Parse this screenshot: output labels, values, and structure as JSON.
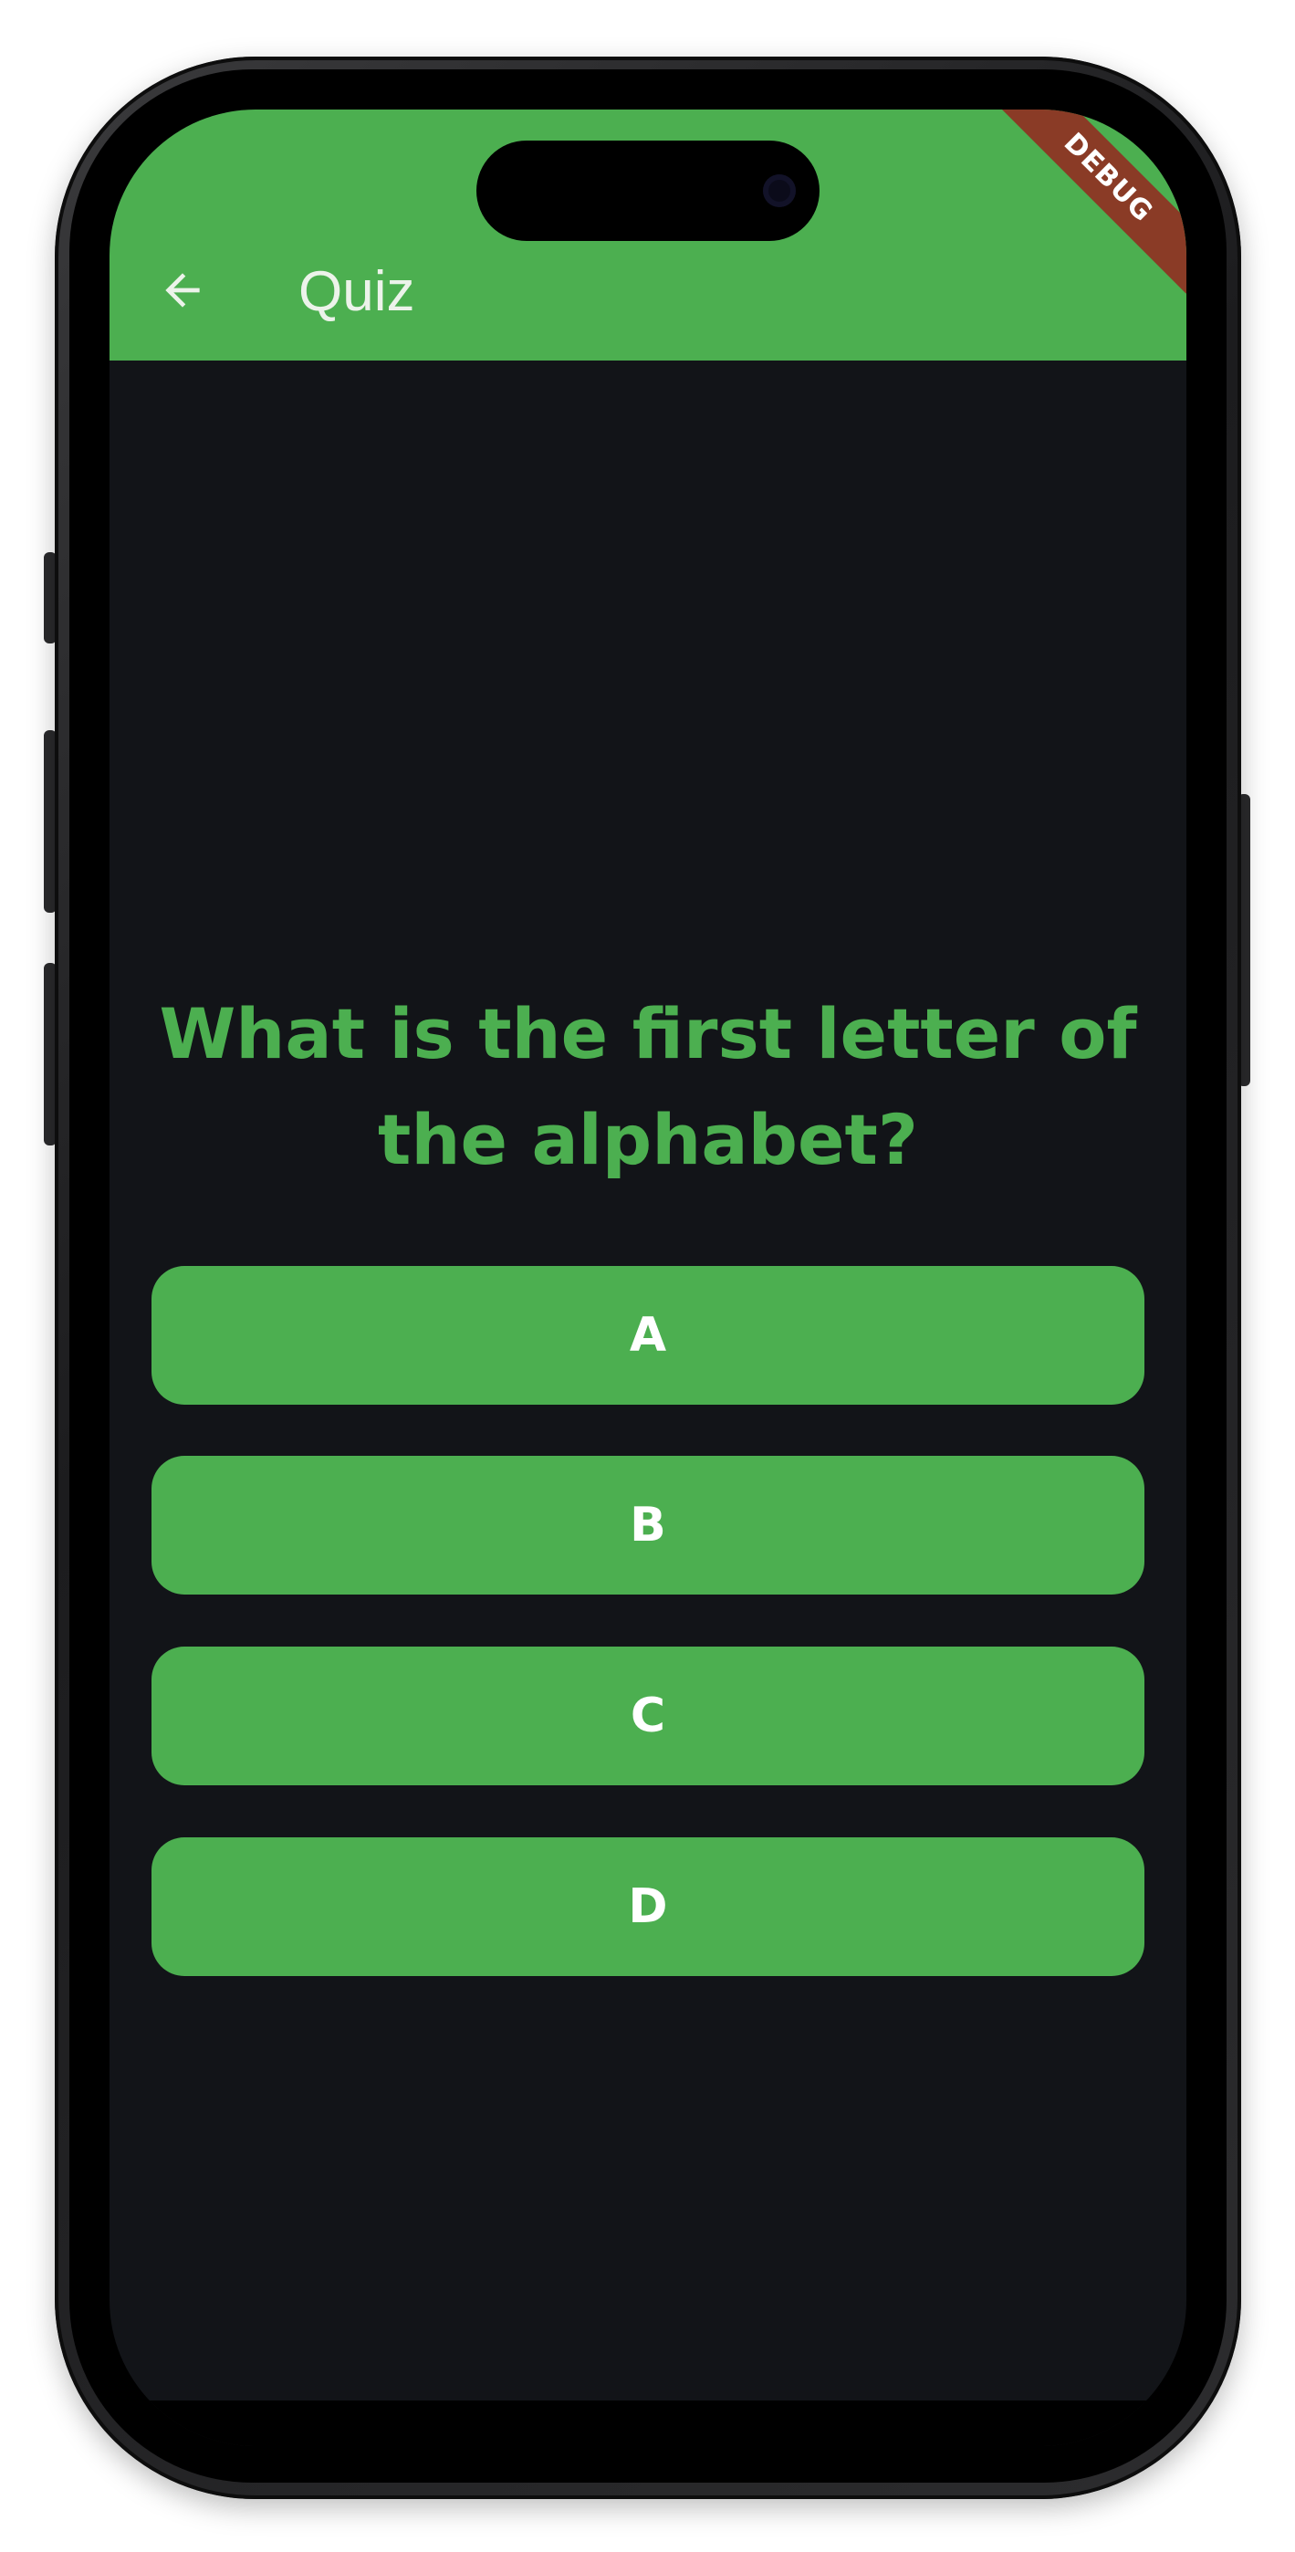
{
  "app_bar": {
    "title": "Quiz",
    "back_icon": "arrow-left-icon",
    "color": "#4caf50"
  },
  "debug_banner": {
    "label": "DEBUG",
    "color": "#8a3b26"
  },
  "quiz": {
    "question": "What is the first letter of the alphabet?",
    "answers": [
      "A",
      "B",
      "C",
      "D"
    ],
    "accent_color": "#4caf50"
  },
  "theme": {
    "background": "#121418",
    "button_text_color": "#ffffff"
  }
}
